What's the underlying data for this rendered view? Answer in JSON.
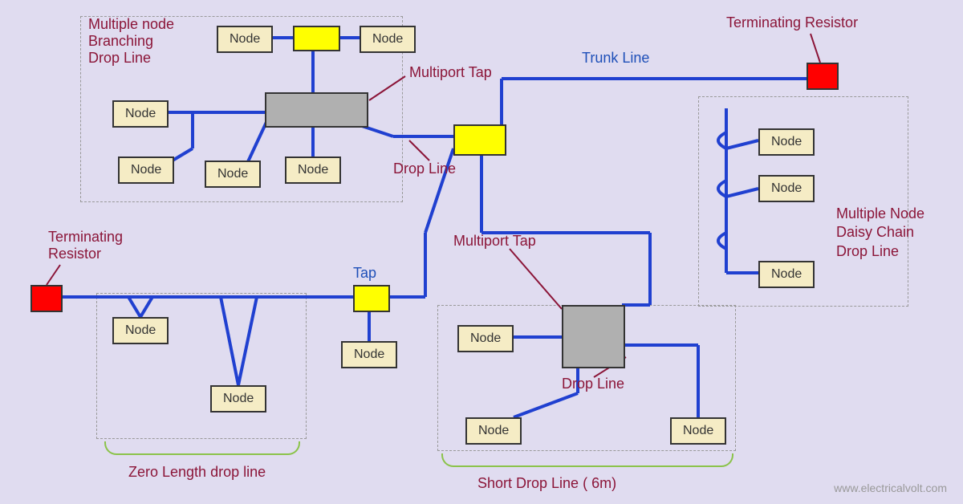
{
  "labels": {
    "node": "Node",
    "multiple_branch1": "Multiple node",
    "multiple_branch2": "Branching",
    "multiple_branch3": "Drop Line",
    "multiport_tap": "Multiport Tap",
    "trunk_line": "Trunk Line",
    "terminating_resistor": "Terminating Resistor",
    "terminating1": "Terminating",
    "resistor1": "Resistor",
    "drop_line": "Drop Line",
    "tap": "Tap",
    "daisy1": "Multiple Node",
    "daisy2": "Daisy Chain",
    "daisy3": "Drop Line",
    "zero_length": "Zero Length drop line",
    "short_drop": "Short Drop Line ( 6m)",
    "watermark": "www.electricalvolt.com"
  }
}
